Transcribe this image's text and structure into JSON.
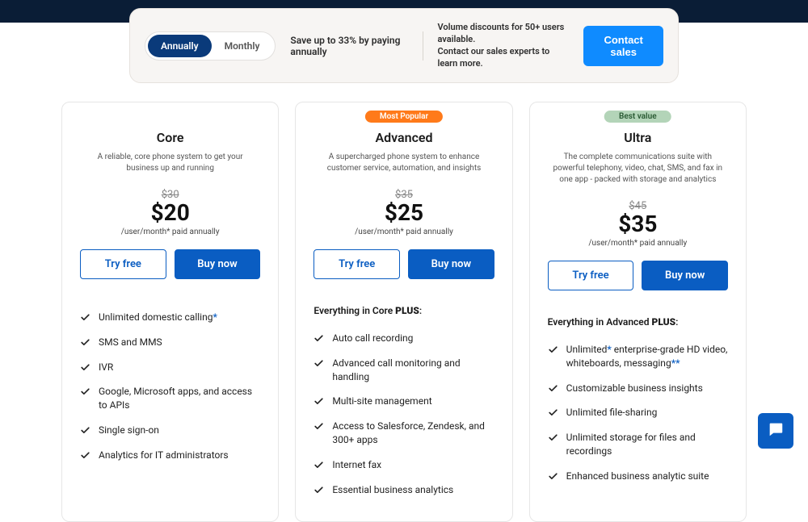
{
  "switcher": {
    "annual": "Annually",
    "monthly": "Monthly",
    "save_text": "Save up to 33% by paying annually",
    "volume_line1": "Volume discounts for 50+ users available.",
    "volume_line2": "Contact our sales experts to learn more.",
    "contact_btn": "Contact sales"
  },
  "plans": [
    {
      "name": "Core",
      "desc": "A reliable, core phone system to get your business up and running",
      "old_price": "$30",
      "price": "$20",
      "price_note": "/user/month*  paid annually",
      "try_label": "Try free",
      "buy_label": "Buy now",
      "inherit": "",
      "features": [
        {
          "text": "Unlimited domestic calling",
          "ast": "*"
        },
        {
          "text": "SMS and MMS"
        },
        {
          "text": "IVR"
        },
        {
          "text": "Google, Microsoft apps, and access to APIs"
        },
        {
          "text": "Single sign-on"
        },
        {
          "text": "Analytics for IT administrators"
        }
      ]
    },
    {
      "name": "Advanced",
      "badge": "Most Popular",
      "badge_color": "orange",
      "desc": "A supercharged phone system to enhance customer service, automation, and insights",
      "old_price": "$35",
      "price": "$25",
      "price_note": "/user/month*  paid annually",
      "try_label": "Try free",
      "buy_label": "Buy now",
      "inherit_prefix": "Everything in Core ",
      "inherit_suffix": "PLUS",
      "features": [
        {
          "text": "Auto call recording"
        },
        {
          "text": "Advanced call monitoring and handling"
        },
        {
          "text": "Multi-site management"
        },
        {
          "text": "Access to Salesforce, Zendesk, and 300+ apps"
        },
        {
          "text": "Internet fax"
        },
        {
          "text": "Essential business analytics"
        }
      ]
    },
    {
      "name": "Ultra",
      "badge": "Best value",
      "badge_color": "green",
      "desc": "The complete communications suite with powerful telephony, video, chat, SMS, and fax in one app - packed with storage and analytics",
      "old_price": "$45",
      "price": "$35",
      "price_note": "/user/month*  paid annually",
      "try_label": "Try free",
      "buy_label": "Buy now",
      "inherit_prefix": "Everything in Advanced ",
      "inherit_suffix": "PLUS",
      "features": [
        {
          "text_pre": "Unlimited",
          "ast_mid": "*",
          "text_post": " enterprise-grade HD video, whiteboards, messaging",
          "ast_end": "**"
        },
        {
          "text": "Customizable business insights"
        },
        {
          "text": "Unlimited file-sharing"
        },
        {
          "text": "Unlimited storage for files and recordings"
        },
        {
          "text": "Enhanced business analytic suite"
        }
      ]
    }
  ]
}
